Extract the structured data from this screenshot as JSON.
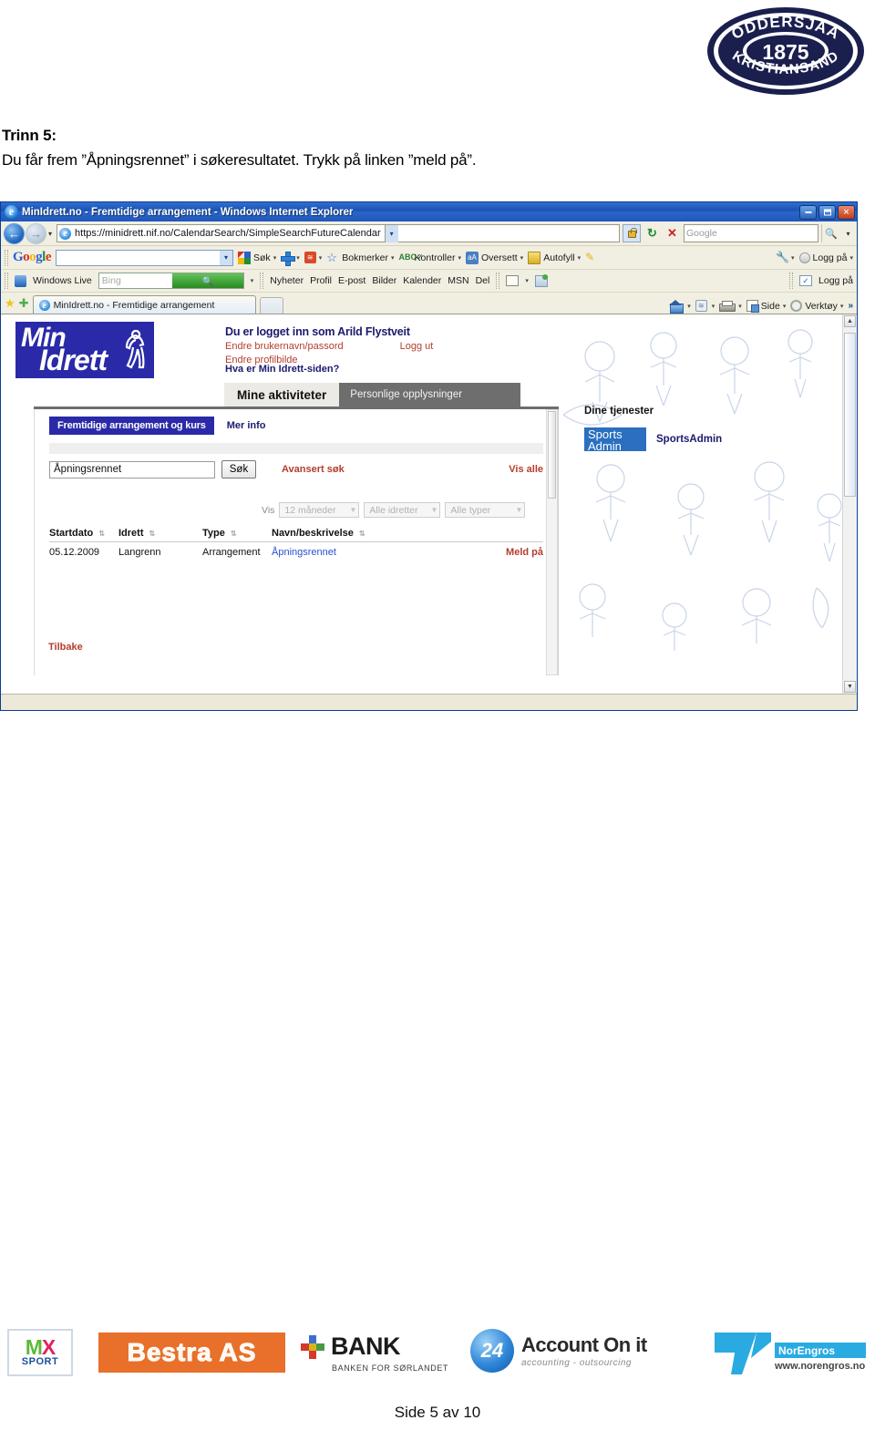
{
  "club_logo": {
    "top_text": "ODDERSJAA",
    "bottom_text": "KRISTIANSAND",
    "year": "1875"
  },
  "instructions": {
    "step_title": "Trinn 5:",
    "step_body": "Du får frem ”Åpningsrennet” i søkeresultatet. Trykk på linken ”meld på”."
  },
  "browser": {
    "title": "MinIdrett.no - Fremtidige arrangement - Windows Internet Explorer",
    "window_buttons": {
      "minimize": "–",
      "maximize": "□",
      "close": "✕"
    },
    "address": {
      "url": "https://minidrett.nif.no/CalendarSearch/SimpleSearchFutureCalendar",
      "search_placeholder": "Google",
      "back_tooltip": "Tilbake",
      "forward_tooltip": "Frem",
      "refresh": "↻",
      "stop": "✕",
      "lock": "lock-icon"
    },
    "google_toolbar": {
      "brand": {
        "g1": "G",
        "o1": "o",
        "o2": "o",
        "g2": "g",
        "l": "l",
        "e": "e"
      },
      "input_value": "",
      "items": [
        {
          "label": "Søk",
          "icon": "google-search-icon"
        },
        {
          "label": "",
          "icon": "plus-icon"
        },
        {
          "label": "",
          "icon": "rss-icon"
        },
        {
          "label": "Bokmerker",
          "icon": "star-icon"
        },
        {
          "label": "Kontroller",
          "icon": "spellcheck-icon"
        },
        {
          "label": "Oversett",
          "icon": "translate-icon"
        },
        {
          "label": "Autofyll",
          "icon": "autofill-icon"
        },
        {
          "label": "",
          "icon": "highlighter-icon"
        },
        {
          "label": "",
          "icon": "wrench-icon"
        },
        {
          "label": "Logg på",
          "icon": "account-icon"
        }
      ]
    },
    "windows_live_toolbar": {
      "brand": "Windows Live",
      "search_placeholder": "Bing",
      "links": [
        "Nyheter",
        "Profil",
        "E-post",
        "Bilder",
        "Kalender",
        "MSN",
        "Del"
      ],
      "signin": "Logg på"
    },
    "tab_bar": {
      "tab_title": "MinIdrett.no - Fremtidige arrangement",
      "favorites_icon": "star-icon",
      "add_favorite_icon": "add-favorite-icon",
      "commands": [
        {
          "label": "",
          "icon": "home-icon"
        },
        {
          "label": "",
          "icon": "feed-icon"
        },
        {
          "label": "",
          "icon": "print-icon"
        },
        {
          "label": "Side",
          "icon": "page-icon"
        },
        {
          "label": "Verktøy",
          "icon": "gear-icon"
        }
      ],
      "overflow": "»"
    }
  },
  "page": {
    "logo": {
      "line1": "Min",
      "line2": "Idrett"
    },
    "user_banner": "Du er logget inn som Arild Flystveit",
    "user_links": {
      "change_credentials": "Endre brukernavn/passord",
      "change_photo": "Endre profilbilde",
      "logout": "Logg ut"
    },
    "help_link": "Hva er Min Idrett-siden?",
    "tabs": [
      {
        "label": "Mine aktiviteter",
        "active": true
      },
      {
        "label": "Personlige opplysninger",
        "active": false
      }
    ],
    "subtabs": {
      "active": "Fremtidige arrangement og kurs",
      "more_info": "Mer info"
    },
    "search": {
      "value": "Åpningsrennet",
      "button": "Søk",
      "advanced": "Avansert søk",
      "show_all": "Vis alle"
    },
    "filters": {
      "label": "Vis",
      "period": "12 måneder",
      "sport": "Alle idretter",
      "type": "Alle typer"
    },
    "results_table": {
      "columns": [
        "Startdato",
        "Idrett",
        "Type",
        "Navn/beskrivelse",
        ""
      ],
      "rows": [
        {
          "startdato": "05.12.2009",
          "idrett": "Langrenn",
          "type": "Arrangement",
          "navn": "Åpningsrennet",
          "action": "Meld på"
        }
      ]
    },
    "back_link": "Tilbake",
    "sidebar": {
      "title": "Dine tjenester",
      "service_logo_line1": "Sports",
      "service_logo_line2": "Admin",
      "service_name": "SportsAdmin"
    }
  },
  "sponsors": [
    {
      "name": "MX SPORT",
      "line1_m": "M",
      "line1_x": "X",
      "line2": "SPORT"
    },
    {
      "name": "Bestra AS",
      "text": "Bestra AS"
    },
    {
      "name": "BANK",
      "word": "BANK",
      "reg": "®",
      "sub": "BANKEN FOR SØRLANDET"
    },
    {
      "name": "24 Account On it",
      "badge": "24",
      "word": "Account On it",
      "reg": "®",
      "sub": "accounting - outsourcing"
    },
    {
      "name": "NorEngros",
      "word": "NorEngros",
      "url": "www.norengros.no"
    }
  ],
  "footer": {
    "page_number": "Side 5 av 10"
  }
}
